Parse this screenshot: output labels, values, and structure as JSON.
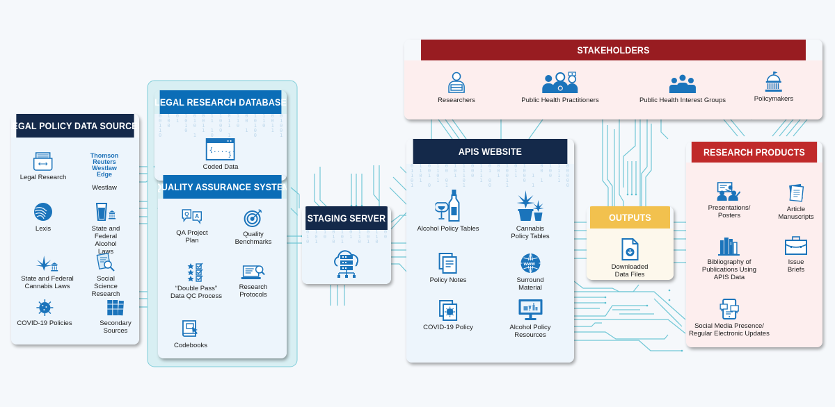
{
  "colors": {
    "navy": "#14294a",
    "blue": "#0b6db7",
    "maroon": "#981c21",
    "red": "#c02a2a",
    "gold": "#f2c14e",
    "icon": "#1b74bb",
    "circuit": "#5bbfd0"
  },
  "legal_sources": {
    "title": "LEGAL POLICY DATA SOURCES",
    "items": [
      {
        "label": "Legal Research",
        "icon": "file-drawer-icon"
      },
      {
        "label": "Westlaw",
        "icon": "westlaw-logo",
        "logo_line1": "Thomson Reuters",
        "logo_line2": "Westlaw Edge"
      },
      {
        "label": "Lexis",
        "icon": "lexis-logo-icon"
      },
      {
        "label": "State and Federal\nAlcohol Laws",
        "icon": "beer-glass-capitol-icon"
      },
      {
        "label": "State and Federal\nCannabis Laws",
        "icon": "cannabis-capitol-icon"
      },
      {
        "label": "Social Science\nResearch",
        "icon": "document-magnifier-icon"
      },
      {
        "label": "COVID-19 Policies",
        "icon": "virus-icon"
      },
      {
        "label": "Secondary\nSources",
        "icon": "books-icon"
      }
    ]
  },
  "legal_db": {
    "title": "LEGAL RESEARCH DATABASE",
    "items": [
      {
        "label": "Coded Data",
        "icon": "code-window-icon"
      }
    ]
  },
  "qa_system": {
    "title": "QUALITY ASSURANCE SYSTEM",
    "items": [
      {
        "label": "QA Project\nPlan",
        "icon": "qa-speech-bubbles-icon"
      },
      {
        "label": "Quality\nBenchmarks",
        "icon": "target-icon"
      },
      {
        "label": "“Double Pass”\nData QC Process",
        "icon": "star-checklist-icon"
      },
      {
        "label": "Research\nProtocols",
        "icon": "laptop-search-icon"
      },
      {
        "label": "Codebooks",
        "icon": "codebook-icon"
      }
    ]
  },
  "staging": {
    "title": "STAGING SERVER",
    "icon": "cloud-server-icon"
  },
  "apis": {
    "title": "APIS WEBSITE",
    "items": [
      {
        "label": "Alcohol Policy Tables",
        "icon": "wine-bottle-icon"
      },
      {
        "label": "Cannabis Policy Tables",
        "icon": "cannabis-plants-icon"
      },
      {
        "label": "Policy Notes",
        "icon": "notes-icon"
      },
      {
        "label": "Surround Material",
        "icon": "www-globe-icon"
      },
      {
        "label": "COVID-19 Policy",
        "icon": "covid-document-icon"
      },
      {
        "label": "Alcohol Policy Resources",
        "icon": "monitor-alcohol-icon"
      }
    ]
  },
  "stakeholders": {
    "title": "STAKEHOLDERS",
    "items": [
      {
        "label": "Researchers",
        "icon": "researcher-icon"
      },
      {
        "label": "Public Health Practitioners",
        "icon": "health-practitioners-icon"
      },
      {
        "label": "Public Health Interest Groups",
        "icon": "group-icon"
      },
      {
        "label": "Policymakers",
        "icon": "capitol-icon"
      }
    ]
  },
  "outputs": {
    "title": "OUTPUTS",
    "items": [
      {
        "label": "Downloaded Data Files",
        "icon": "download-file-icon"
      }
    ]
  },
  "research_products": {
    "title": "RESEARCH PRODUCTS",
    "items": [
      {
        "label": "Presentations/\nPosters",
        "icon": "presentation-icon"
      },
      {
        "label": "Article\nManuscripts",
        "icon": "manuscript-icon"
      },
      {
        "label": "Bibliography of\nPublications Using\nAPIS Data",
        "icon": "bookshelf-icon"
      },
      {
        "label": "Issue Briefs",
        "icon": "briefcase-icon"
      },
      {
        "label": "Social Media Presence/\nRegular Electronic Updates",
        "icon": "tablet-chat-icon"
      }
    ]
  }
}
